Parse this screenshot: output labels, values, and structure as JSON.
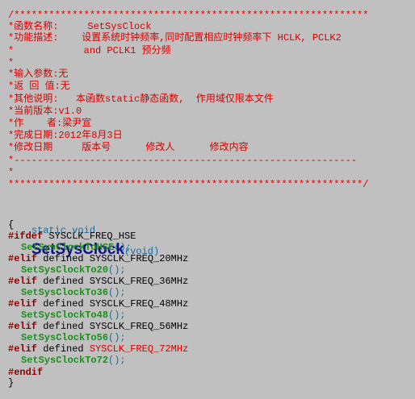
{
  "comment": {
    "top_border": "/*************************************************************",
    "lines": [
      "*函数名称:     SetSysClock",
      "*功能描述:    设置系统时钟频率,同时配置相应时钟频率下 HCLK, PCLK2",
      "*            and PCLK1 预分频",
      "*",
      "*输入参数:无",
      "*返 回 值:无",
      "*其他说明:   本函数static静态函数,  作用域仅限本文件",
      "*当前版本:v1.0",
      "*作    者:梁尹宣",
      "*完成日期:2012年8月3日",
      "*修改日期     版本号      修改人      修改内容",
      "*-----------------------------------------------------------",
      "*",
      "*************************************************************/"
    ]
  },
  "code": {
    "signature": {
      "type": "static void",
      "name": "SetSysClock",
      "args": "(void)"
    },
    "open_brace": "{",
    "branches": [
      {
        "directive": "#ifdef",
        "defined": "",
        "macro": "SYSCLK_FREQ_HSE",
        "macro_active": false,
        "call": "SetSysClockToHSE",
        "call_tail": "();"
      },
      {
        "directive": "#elif",
        "defined": "defined",
        "macro": "SYSCLK_FREQ_20MHz",
        "macro_active": false,
        "call": "SetSysClockTo20",
        "call_tail": "();"
      },
      {
        "directive": "#elif",
        "defined": "defined",
        "macro": "SYSCLK_FREQ_36MHz",
        "macro_active": false,
        "call": "SetSysClockTo36",
        "call_tail": "();"
      },
      {
        "directive": "#elif",
        "defined": "defined",
        "macro": "SYSCLK_FREQ_48MHz",
        "macro_active": false,
        "call": "SetSysClockTo48",
        "call_tail": "();"
      },
      {
        "directive": "#elif",
        "defined": "defined",
        "macro": "SYSCLK_FREQ_56MHz",
        "macro_active": false,
        "call": "SetSysClockTo56",
        "call_tail": "();"
      },
      {
        "directive": "#elif",
        "defined": "defined",
        "macro": "SYSCLK_FREQ_72MHz",
        "macro_active": true,
        "call": "SetSysClockTo72",
        "call_tail": "();"
      }
    ],
    "endif": "#endif",
    "close_brace": "}"
  },
  "colors": {
    "background": "#c0c0c0",
    "comment": "#d80000",
    "keyword": "#1a6b9c",
    "function_name": "#0c0c8c",
    "preprocessor": "#8b0000",
    "call": "#1b8f1b",
    "active_macro": "#d80000"
  }
}
